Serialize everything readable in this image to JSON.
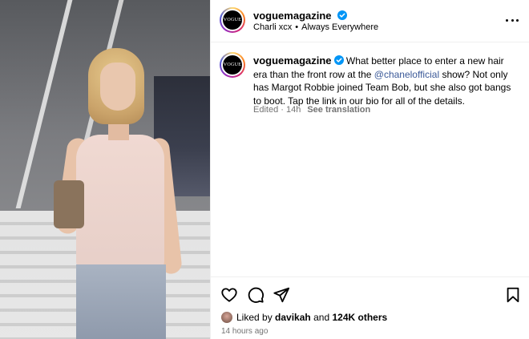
{
  "post": {
    "username": "voguemagazine",
    "avatar_text": "VOGUE",
    "audio": "Charli xcx",
    "audio_separator": "•",
    "audio_extra": "Always Everywhere",
    "caption": {
      "username": "voguemagazine",
      "text_before": "What better place to enter a new hair era than the front row at the ",
      "mention": "@chanelofficial",
      "text_after": " show? Not only has Margot Robbie joined Team Bob, but she also got bangs to boot. Tap the link in our bio for all of the details.",
      "edited": "Edited · 14h",
      "see_translation": "See translation"
    },
    "likes": {
      "prefix": "Liked by",
      "user": "davikah",
      "and": "and",
      "count": "124K others"
    },
    "timestamp": "14 hours ago"
  },
  "icons": {
    "verified": "verified-badge-icon",
    "more": "more-options-icon",
    "like": "heart-icon",
    "comment": "comment-icon",
    "share": "send-icon",
    "save": "bookmark-icon"
  },
  "colors": {
    "verified": "#0095f6",
    "mention": "#3b5998",
    "secondary_text": "#737373"
  }
}
